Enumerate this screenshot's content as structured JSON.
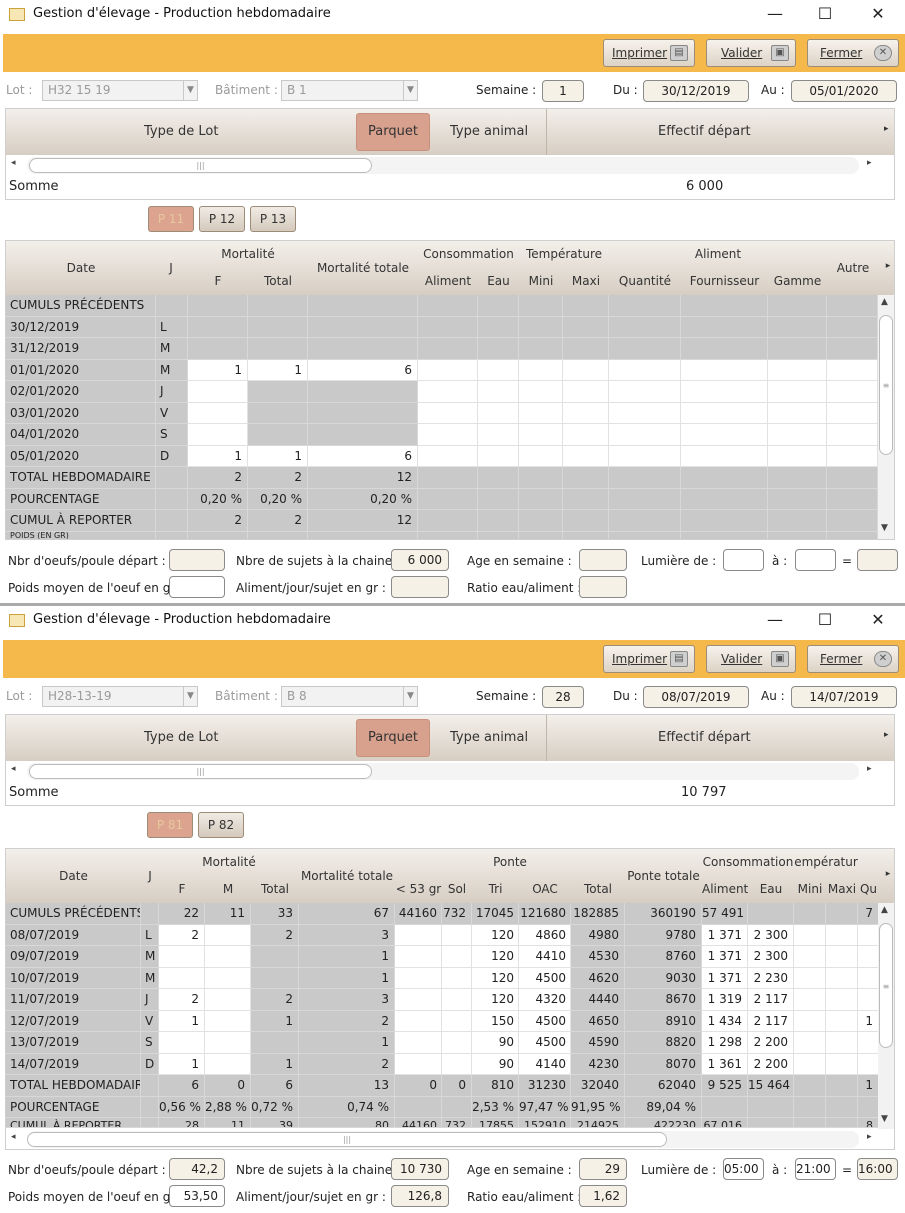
{
  "w1": {
    "title": "Gestion d'élevage - Production hebdomadaire",
    "toolbar": {
      "print": "Imprimer",
      "validate": "Valider",
      "close": "Fermer"
    },
    "filters": {
      "lot_label": "Lot :",
      "lot_value": "H32 15 19",
      "building_label": "Bâtiment :",
      "building_value": "B 1",
      "week_label": "Semaine :",
      "week": "1",
      "from_label": "Du :",
      "from": "30/12/2019",
      "to_label": "Au :",
      "to": "05/01/2020"
    },
    "lot": {
      "col_type": "Type de Lot",
      "col_parquet": "Parquet",
      "col_animal": "Type animal",
      "col_effectif": "Effectif départ",
      "somme_label": "Somme",
      "somme_value": "6 000"
    },
    "parquets": [
      "P 11",
      "P 12",
      "P 13"
    ],
    "headers": {
      "date": "Date",
      "j": "J",
      "mortalite": "Mortalité",
      "f": "F",
      "total": "Total",
      "mort_totale": "Mortalité totale",
      "conso": "Consommation",
      "aliment": "Aliment",
      "eau": "Eau",
      "temperature": "Température",
      "mini": "Mini",
      "maxi": "Maxi",
      "aliment_grp": "Aliment",
      "quantite": "Quantité",
      "fournisseur": "Fournisseur",
      "gamme": "Gamme",
      "autre": "Autre"
    },
    "rows": [
      {
        "date": "CUMULS PRÉCÉDENTS",
        "j": "",
        "f": "",
        "total": "",
        "mt": "",
        "kind": "cum"
      },
      {
        "date": "30/12/2019",
        "j": "L",
        "f": "",
        "total": "",
        "mt": "",
        "kind": "grey"
      },
      {
        "date": "31/12/2019",
        "j": "M",
        "f": "",
        "total": "",
        "mt": "",
        "kind": "grey"
      },
      {
        "date": "01/01/2020",
        "j": "M",
        "f": "1",
        "total": "1",
        "mt": "6",
        "kind": "day"
      },
      {
        "date": "02/01/2020",
        "j": "J",
        "f": "",
        "total": "",
        "mt": "",
        "kind": "day"
      },
      {
        "date": "03/01/2020",
        "j": "V",
        "f": "",
        "total": "",
        "mt": "",
        "kind": "day"
      },
      {
        "date": "04/01/2020",
        "j": "S",
        "f": "",
        "total": "",
        "mt": "",
        "kind": "day"
      },
      {
        "date": "05/01/2020",
        "j": "D",
        "f": "1",
        "total": "1",
        "mt": "6",
        "kind": "day"
      },
      {
        "date": "TOTAL HEBDOMADAIRE",
        "j": "",
        "f": "2",
        "total": "2",
        "mt": "12",
        "kind": "sum"
      },
      {
        "date": "POURCENTAGE",
        "j": "",
        "f": "0,20 %",
        "total": "0,20 %",
        "mt": "0,20 %",
        "kind": "sum"
      },
      {
        "date": "CUMUL À REPORTER",
        "j": "",
        "f": "2",
        "total": "2",
        "mt": "12",
        "kind": "sum"
      },
      {
        "date": "POIDS (EN GR)",
        "j": "",
        "f": "",
        "total": "",
        "mt": "",
        "kind": "cut"
      }
    ],
    "bottom": {
      "oeufs_label": "Nbr d'oeufs/poule départ :",
      "oeufs": "",
      "sujets_label": "Nbre de sujets à la chaine :",
      "sujets": "6 000",
      "age_label": "Age en semaine :",
      "age": "",
      "lumiere_label": "Lumière de :",
      "lum_from": "",
      "a_label": "à :",
      "lum_to": "",
      "eq_label": "=",
      "lum_total": "",
      "poids_label": "Poids moyen de l'oeuf en gr :",
      "poids": "",
      "aliment_label": "Aliment/jour/sujet en gr :",
      "aliment": "",
      "ratio_label": "Ratio eau/aliment :",
      "ratio": ""
    }
  },
  "w2": {
    "title": "Gestion d'élevage - Production hebdomadaire",
    "toolbar": {
      "print": "Imprimer",
      "validate": "Valider",
      "close": "Fermer"
    },
    "filters": {
      "lot_label": "Lot :",
      "lot_value": "H28-13-19",
      "building_label": "Bâtiment :",
      "building_value": "B 8",
      "week_label": "Semaine :",
      "week": "28",
      "from_label": "Du :",
      "from": "08/07/2019",
      "to_label": "Au :",
      "to": "14/07/2019"
    },
    "lot": {
      "col_type": "Type de Lot",
      "col_parquet": "Parquet",
      "col_animal": "Type animal",
      "col_effectif": "Effectif départ",
      "somme_label": "Somme",
      "somme_value": "10 797"
    },
    "parquets": [
      "P 81",
      "P 82"
    ],
    "headers": {
      "date": "Date",
      "j": "J",
      "mortalite": "Mortalité",
      "f": "F",
      "m": "M",
      "total": "Total",
      "mort_totale": "Mortalité totale",
      "ponte": "Ponte",
      "lt53": "< 53 gr",
      "sol": "Sol",
      "tri": "Tri",
      "oac": "OAC",
      "ptotal": "Total",
      "ponte_totale": "Ponte totale",
      "conso": "Consommation",
      "aliment": "Aliment",
      "eau": "Eau",
      "temperature": "empératur",
      "mini": "Mini",
      "maxi": "Maxi",
      "qu": "Qu"
    },
    "rows": [
      {
        "date": "CUMULS PRÉCÉDENTS",
        "j": "",
        "f": "22",
        "m": "11",
        "total": "33",
        "mt": "67",
        "lt53": "44160",
        "sol": "732",
        "tri": "17045",
        "oac": "121680",
        "pt": "182885",
        "ptot": "360190",
        "ali": "57 491",
        "eau": "",
        "mini": "",
        "maxi": "",
        "qu": "7",
        "kind": "cum"
      },
      {
        "date": "08/07/2019",
        "j": "L",
        "f": "2",
        "m": "",
        "total": "2",
        "mt": "3",
        "lt53": "",
        "sol": "",
        "tri": "120",
        "oac": "4860",
        "pt": "4980",
        "ptot": "9780",
        "ali": "1 371",
        "eau": "2 300",
        "mini": "",
        "maxi": "",
        "qu": "",
        "kind": "day"
      },
      {
        "date": "09/07/2019",
        "j": "M",
        "f": "",
        "m": "",
        "total": "",
        "mt": "1",
        "lt53": "",
        "sol": "",
        "tri": "120",
        "oac": "4410",
        "pt": "4530",
        "ptot": "8760",
        "ali": "1 371",
        "eau": "2 300",
        "mini": "",
        "maxi": "",
        "qu": "",
        "kind": "day"
      },
      {
        "date": "10/07/2019",
        "j": "M",
        "f": "",
        "m": "",
        "total": "",
        "mt": "1",
        "lt53": "",
        "sol": "",
        "tri": "120",
        "oac": "4500",
        "pt": "4620",
        "ptot": "9030",
        "ali": "1 371",
        "eau": "2 230",
        "mini": "",
        "maxi": "",
        "qu": "",
        "kind": "day"
      },
      {
        "date": "11/07/2019",
        "j": "J",
        "f": "2",
        "m": "",
        "total": "2",
        "mt": "3",
        "lt53": "",
        "sol": "",
        "tri": "120",
        "oac": "4320",
        "pt": "4440",
        "ptot": "8670",
        "ali": "1 319",
        "eau": "2 117",
        "mini": "",
        "maxi": "",
        "qu": "",
        "kind": "day"
      },
      {
        "date": "12/07/2019",
        "j": "V",
        "f": "1",
        "m": "",
        "total": "1",
        "mt": "2",
        "lt53": "",
        "sol": "",
        "tri": "150",
        "oac": "4500",
        "pt": "4650",
        "ptot": "8910",
        "ali": "1 434",
        "eau": "2 117",
        "mini": "",
        "maxi": "",
        "qu": "1",
        "kind": "day"
      },
      {
        "date": "13/07/2019",
        "j": "S",
        "f": "",
        "m": "",
        "total": "",
        "mt": "1",
        "lt53": "",
        "sol": "",
        "tri": "90",
        "oac": "4500",
        "pt": "4590",
        "ptot": "8820",
        "ali": "1 298",
        "eau": "2 200",
        "mini": "",
        "maxi": "",
        "qu": "",
        "kind": "day"
      },
      {
        "date": "14/07/2019",
        "j": "D",
        "f": "1",
        "m": "",
        "total": "1",
        "mt": "2",
        "lt53": "",
        "sol": "",
        "tri": "90",
        "oac": "4140",
        "pt": "4230",
        "ptot": "8070",
        "ali": "1 361",
        "eau": "2 200",
        "mini": "",
        "maxi": "",
        "qu": "",
        "kind": "day"
      },
      {
        "date": "TOTAL HEBDOMADAIRE",
        "j": "",
        "f": "6",
        "m": "0",
        "total": "6",
        "mt": "13",
        "lt53": "0",
        "sol": "0",
        "tri": "810",
        "oac": "31230",
        "pt": "32040",
        "ptot": "62040",
        "ali": "9 525",
        "eau": "15 464",
        "mini": "",
        "maxi": "",
        "qu": "1",
        "kind": "sum"
      },
      {
        "date": "POURCENTAGE",
        "j": "",
        "f": "0,56 %",
        "m": "2,88 %",
        "total": "0,72 %",
        "mt": "0,74 %",
        "lt53": "",
        "sol": "",
        "tri": "2,53 %",
        "oac": "97,47 %",
        "pt": "91,95 %",
        "ptot": "89,04 %",
        "ali": "",
        "eau": "",
        "mini": "",
        "maxi": "",
        "qu": "",
        "kind": "sum"
      },
      {
        "date": "CUMUL À REPORTER",
        "j": "",
        "f": "28",
        "m": "11",
        "total": "39",
        "mt": "80",
        "lt53": "44160",
        "sol": "732",
        "tri": "17855",
        "oac": "152910",
        "pt": "214925",
        "ptot": "422230",
        "ali": "67 016",
        "eau": "",
        "mini": "",
        "maxi": "",
        "qu": "8",
        "kind": "cut"
      }
    ],
    "bottom": {
      "oeufs_label": "Nbr d'oeufs/poule départ :",
      "oeufs": "42,2",
      "sujets_label": "Nbre de sujets à la chaine :",
      "sujets": "10 730",
      "age_label": "Age en semaine :",
      "age": "29",
      "lumiere_label": "Lumière de :",
      "lum_from": "05:00",
      "a_label": "à :",
      "lum_to": "21:00",
      "eq_label": "=",
      "lum_total": "16:00",
      "poids_label": "Poids moyen de l'oeuf en gr :",
      "poids": "53,50",
      "aliment_label": "Aliment/jour/sujet en gr :",
      "aliment": "126,8",
      "ratio_label": "Ratio eau/aliment :",
      "ratio": "1,62"
    }
  }
}
